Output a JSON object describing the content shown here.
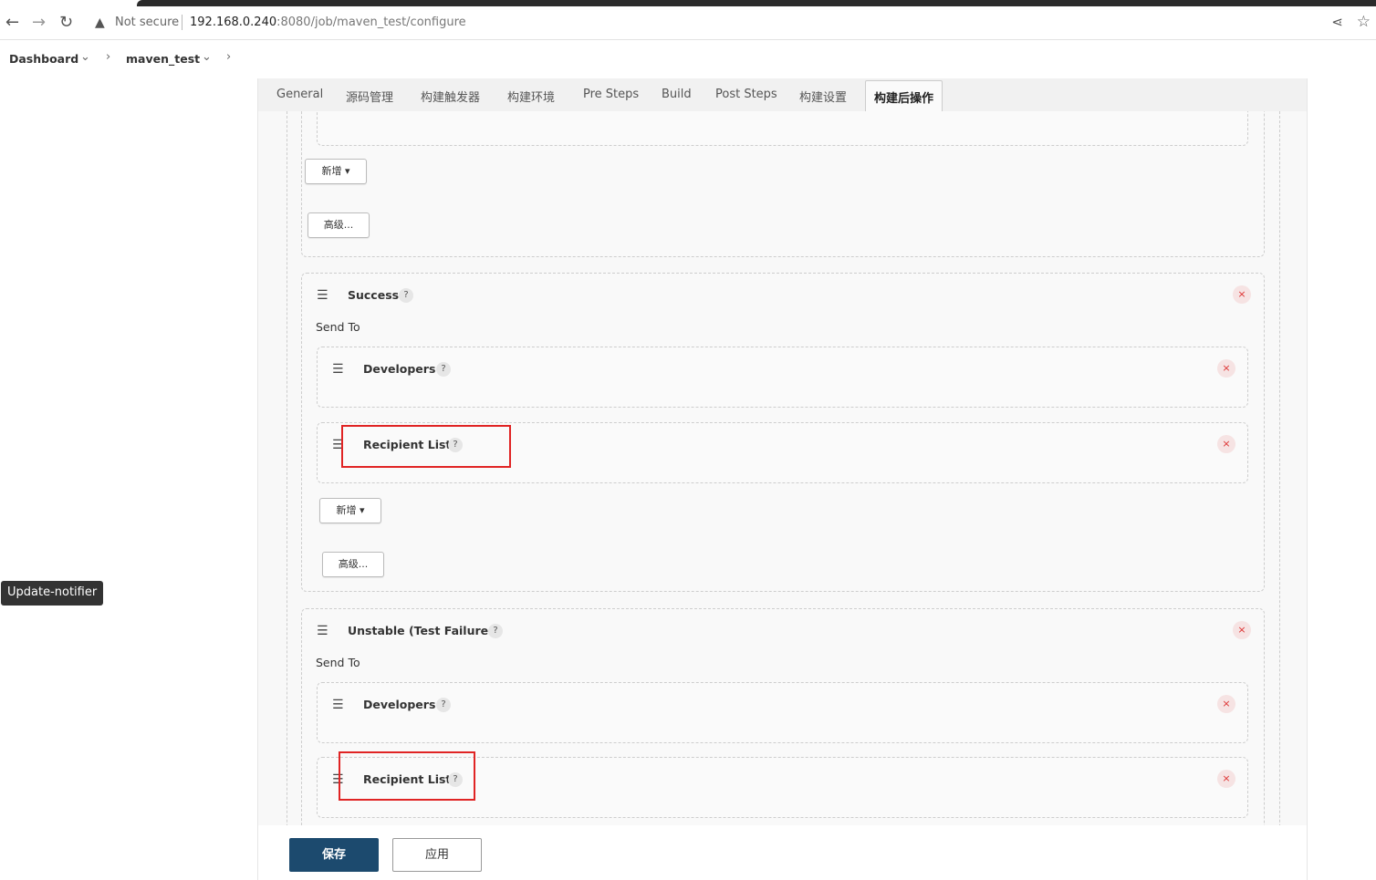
{
  "browser": {
    "back_icon": "arrow-left-icon",
    "forward_icon": "arrow-right-icon",
    "reload_icon": "reload-icon",
    "security_text": "Not secure",
    "url_host": "192.168.0.240",
    "url_path": ":8080/job/maven_test/configure"
  },
  "breadcrumb": {
    "dashboard": "Dashboard",
    "job": "maven_test"
  },
  "tooltip": "Update-notifier",
  "tabs": [
    {
      "label": "General"
    },
    {
      "label": "源码管理"
    },
    {
      "label": "构建触发器"
    },
    {
      "label": "构建环境"
    },
    {
      "label": "Pre Steps"
    },
    {
      "label": "Build"
    },
    {
      "label": "Post Steps"
    },
    {
      "label": "构建设置"
    },
    {
      "label": "构建后操作",
      "active": true
    }
  ],
  "buttons": {
    "add": "新增 ▾",
    "advanced": "高级...",
    "save": "保存",
    "apply": "应用"
  },
  "send_to_label": "Send To",
  "help_glyph": "?",
  "close_glyph": "×",
  "triggers": [
    {
      "title": "Success",
      "recipients": [
        {
          "title": "Developers"
        },
        {
          "title": "Recipient List",
          "highlighted": true
        }
      ]
    },
    {
      "title": "Unstable (Test Failures)",
      "recipients": [
        {
          "title": "Developers"
        },
        {
          "title": "Recipient List",
          "highlighted": true
        }
      ]
    }
  ],
  "colors": {
    "save_button": "#1c4a6e",
    "highlight": "#e02424",
    "close_icon": "#d33333"
  }
}
